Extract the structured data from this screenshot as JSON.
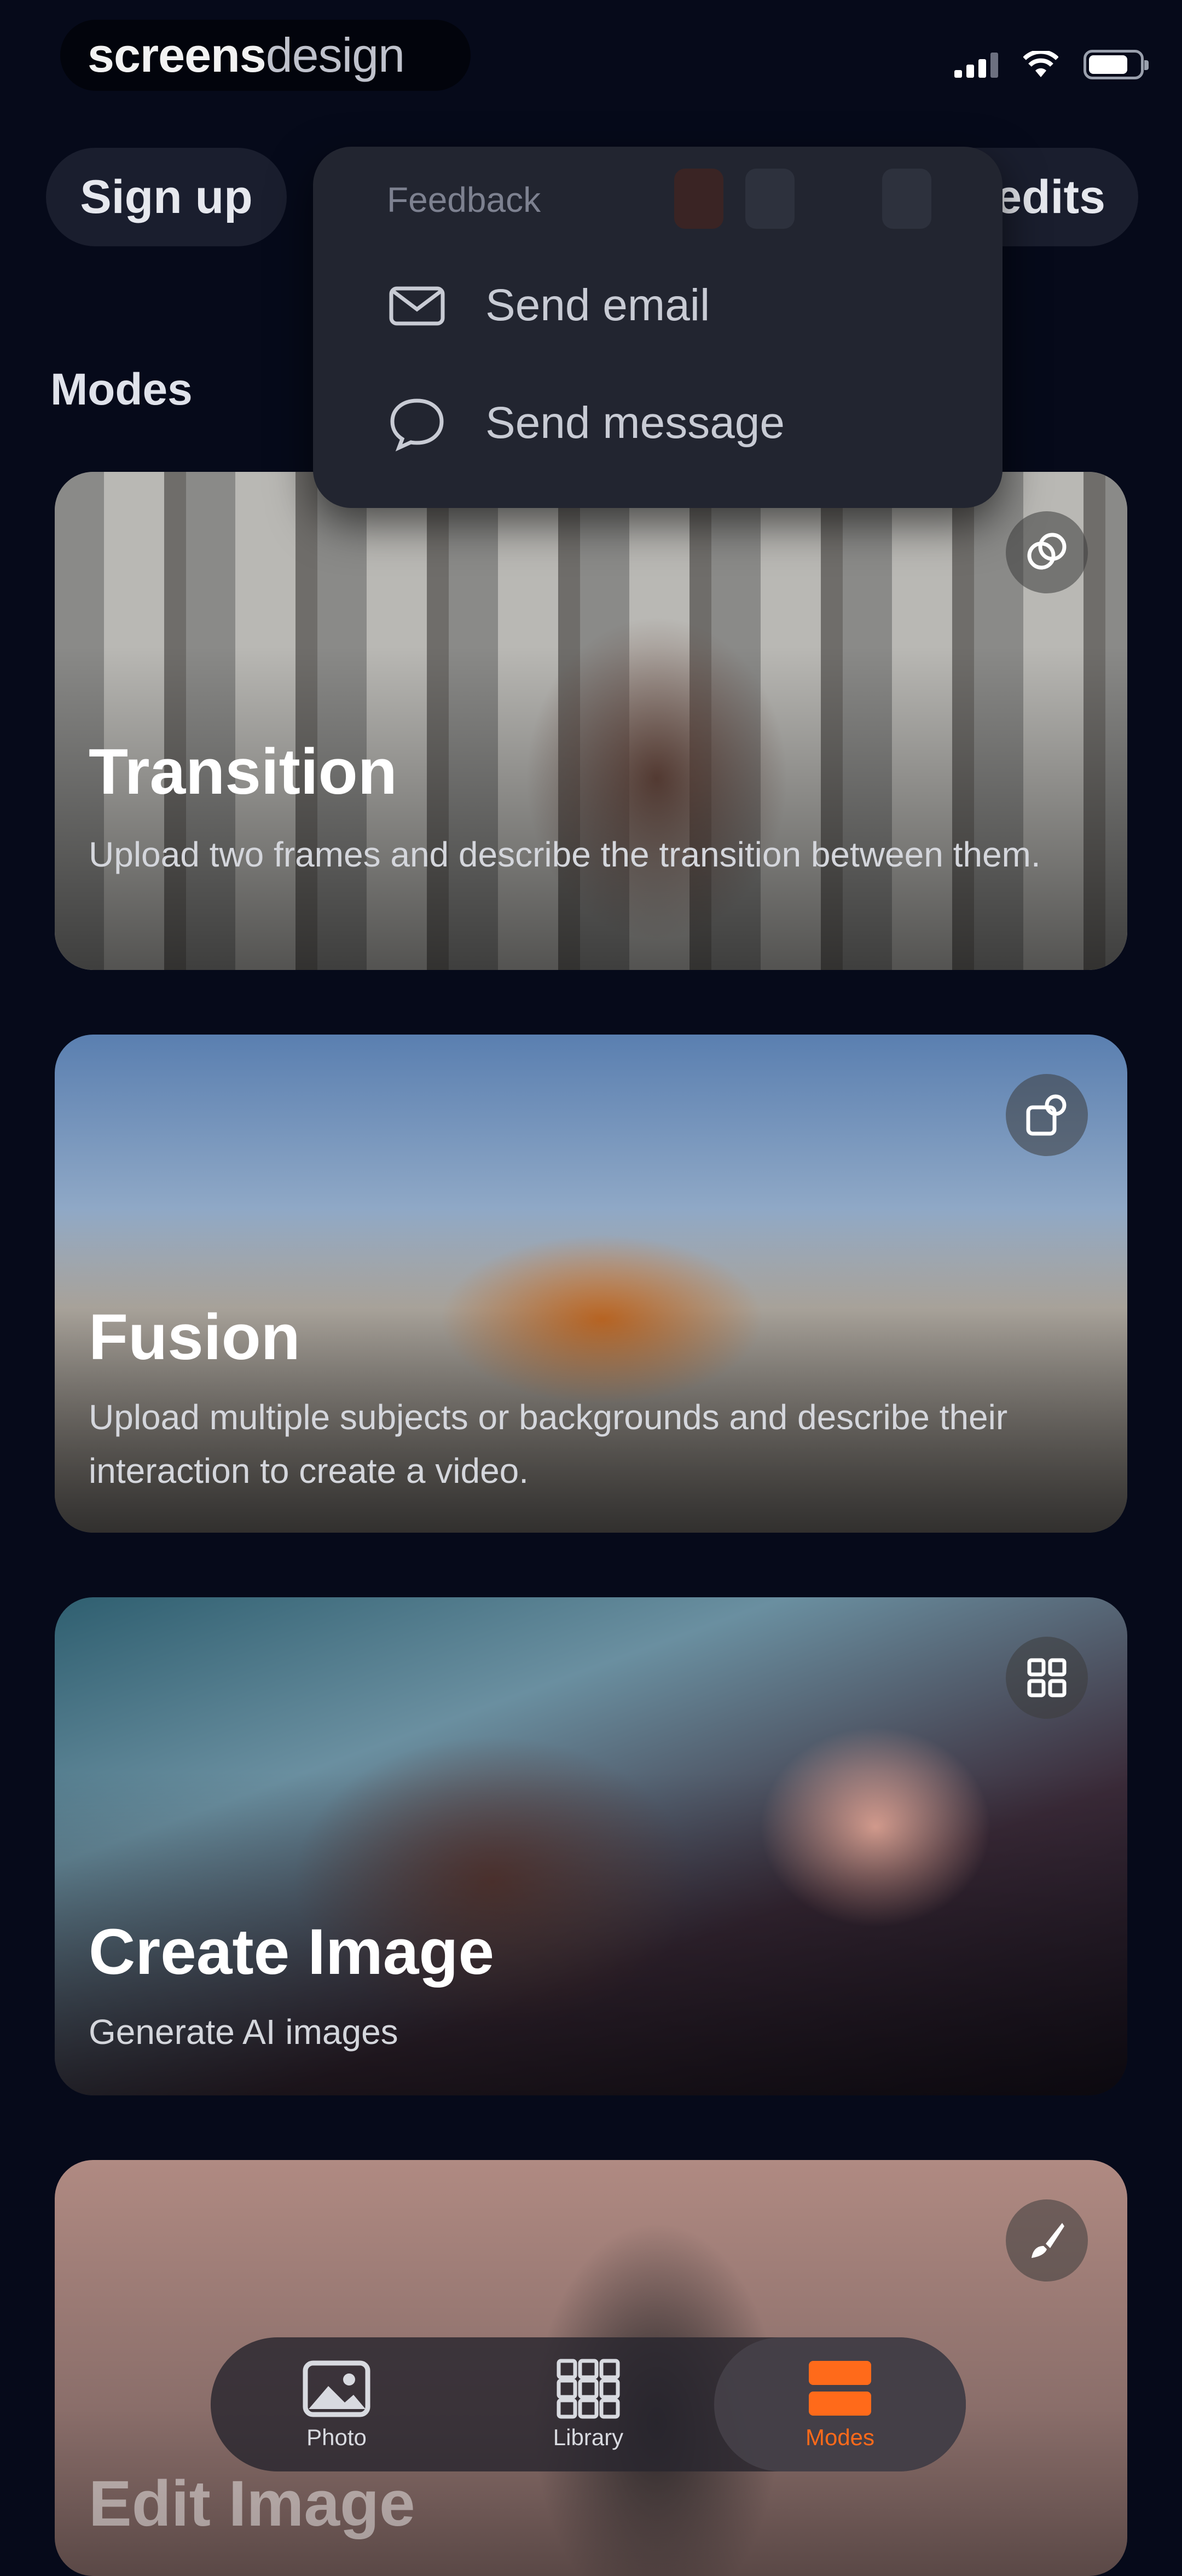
{
  "watermark": {
    "part1": "screens",
    "part2": "design"
  },
  "header": {
    "signup_label": "Sign up",
    "credits_label": "Credits"
  },
  "feedback_menu": {
    "title": "Feedback",
    "items": [
      {
        "label": "Send email",
        "icon": "mail-icon"
      },
      {
        "label": "Send message",
        "icon": "chat-bubble-icon"
      }
    ]
  },
  "modes_title": "Modes",
  "cards": [
    {
      "title": "Transition",
      "description": "Upload two frames and describe the transition between them.",
      "icon": "transition-icon"
    },
    {
      "title": "Fusion",
      "description": "Upload multiple subjects or backgrounds and describe their interaction to create a video.",
      "icon": "fusion-icon"
    },
    {
      "title": "Create Image",
      "description": "Generate AI images",
      "icon": "image-grid-icon"
    },
    {
      "title": "Edit Image",
      "description": "",
      "icon": "brush-icon"
    }
  ],
  "tabbar": {
    "tabs": [
      {
        "label": "Photo",
        "icon": "photo-icon"
      },
      {
        "label": "Library",
        "icon": "grid-icon"
      },
      {
        "label": "Modes",
        "icon": "modes-icon"
      }
    ],
    "active_index": 2
  },
  "colors": {
    "background": "#060a1a",
    "accent": "#ff6a1a",
    "menu": "#222530"
  }
}
